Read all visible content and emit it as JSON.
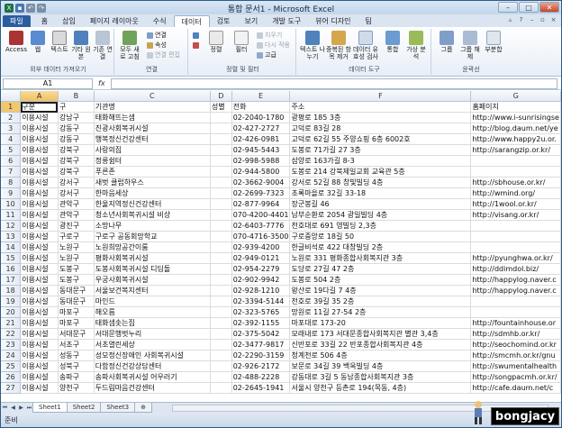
{
  "window": {
    "title": "통합 문서1 - Microsoft Excel"
  },
  "tabs": [
    "파일",
    "홈",
    "삽입",
    "페이지 레이아웃",
    "수식",
    "데이터",
    "검토",
    "보기",
    "개발 도구",
    "뷰어 디자인",
    "팀"
  ],
  "active_tab": "데이터",
  "ribbon": {
    "groups": [
      {
        "caption": "외부 데이터 가져오기",
        "buttons": [
          "Access",
          "웹",
          "텍스트",
          "기타 원본",
          "기존 연결"
        ]
      },
      {
        "caption": "연결",
        "buttons": [
          "모두 새로 고침"
        ],
        "small": [
          "연결",
          "속성",
          "연결 편집"
        ]
      },
      {
        "caption": "정렬 및 필터",
        "buttons": [
          "정렬",
          "필터"
        ],
        "small": [
          "지우기",
          "다시 적용",
          "고급"
        ]
      },
      {
        "caption": "데이터 도구",
        "buttons": [
          "텍스트 나누기",
          "중복된 항목 제거",
          "데이터 유효성 검사",
          "통합",
          "가상 분석"
        ]
      },
      {
        "caption": "윤곽선",
        "buttons": [
          "그룹",
          "그룹 해제",
          "부분합"
        ]
      }
    ]
  },
  "formula_bar": {
    "name_box": "A1",
    "fx": "fx",
    "value": ""
  },
  "columns": [
    "A",
    "B",
    "C",
    "D",
    "E",
    "F",
    "G"
  ],
  "rows": [
    [
      "구분",
      "구",
      "기관명",
      "성별",
      "전화",
      "주소",
      "홈페이지"
    ],
    [
      "이용시설",
      "강남구",
      "태화해뜨는샘",
      "",
      "02-2040-1780",
      "광평로 185 3층",
      "http://www.i-sunrisingse"
    ],
    [
      "이용시설",
      "강동구",
      "진광사회복귀시설",
      "",
      "02-427-2727",
      "고덕로 83길 28",
      "http://blog.daum.net/ye"
    ],
    [
      "이용시설",
      "강동구",
      "행복정신건강센터",
      "",
      "02-426-0981",
      "고덕로 62길 55 주양쇼핑 6층 6002호",
      "http://www.happy2u.or."
    ],
    [
      "이용시설",
      "강북구",
      "사랑의집",
      "",
      "02-945-5443",
      "도봉로 71가길 27 3층",
      "http://sarangzip.or.kr/"
    ],
    [
      "이용시설",
      "강북구",
      "정릉쉼터",
      "",
      "02-998-5988",
      "삼양로 163가길 8-3",
      ""
    ],
    [
      "이용시설",
      "강북구",
      "푸른존",
      "",
      "02-944-5800",
      "도봉로 214 강북제일교회 교육관 5층",
      ""
    ],
    [
      "이용시설",
      "강서구",
      "새벗 클럽하우스",
      "",
      "02-3662-9004",
      "강서로 52길 88 창빛빌딩 4층",
      "http://sbhouse.or.kr/"
    ],
    [
      "이용시설",
      "강서구",
      "한마음세상",
      "",
      "02-2699-7323",
      "초록마을로 32길 33-18",
      "http://wmind.org/"
    ],
    [
      "이용시설",
      "관악구",
      "한울지역정신건강센터",
      "",
      "02-877-9964",
      "장군봉길 46",
      "http://1wool.or.kr/"
    ],
    [
      "이용시설",
      "관악구",
      "청소년사회복귀시설 비상",
      "",
      "070-4200-4401",
      "남부순환로 2054 광일빌딩 4층",
      "http://visang.or.kr/"
    ],
    [
      "이용시설",
      "광진구",
      "소망나무",
      "",
      "02-6403-7776",
      "천호대로 691 영빌딩 2,3층",
      ""
    ],
    [
      "이용시설",
      "구로구",
      "구로구 공동회망학교",
      "",
      "070-4716-3500",
      "구로중앙로 18길 50",
      ""
    ],
    [
      "이용시설",
      "노원구",
      "노원희망공간이룸",
      "",
      "02-939-4200",
      "한글비석로 422 대창빌딩 2층",
      ""
    ],
    [
      "이용시설",
      "노원구",
      "평화사회복귀시설",
      "",
      "02-949-0121",
      "노원로 331 평화종합사회복지관 3층",
      "http://pyunghwa.or.kr/"
    ],
    [
      "이용시설",
      "도봉구",
      "도봉사회복귀시설 디딤돌",
      "",
      "02-954-2279",
      "도당로 27길 47 2층",
      "http://ddimdol.biz/"
    ],
    [
      "이용시설",
      "도봉구",
      "우궁사회복귀시설",
      "",
      "02-902-9942",
      "도봉로 504 2층",
      "http://happylog.naver.c"
    ],
    [
      "이용시설",
      "동대문구",
      "서울보건복지센터",
      "",
      "02-928-1210",
      "왕산로 19다길 7 4층",
      "http://happylog.naver.c"
    ],
    [
      "이용시설",
      "동대문구",
      "마인드",
      "",
      "02-3394-5144",
      "천호로 39길 35 2층",
      ""
    ],
    [
      "이용시설",
      "마포구",
      "해오름",
      "",
      "02-323-5765",
      "망원로 11길 27-54 2층",
      ""
    ],
    [
      "이용시설",
      "마포구",
      "태화샘솟는집",
      "",
      "02-392-1155",
      "마포대로 173-20",
      "http://fountainhouse.or"
    ],
    [
      "이용시설",
      "서대문구",
      "서대문행벗누리",
      "",
      "02-375-5042",
      "모래내로 173 서대문종합사회복지관 별관 3,4층",
      "http://sdmhb.or.kr/"
    ],
    [
      "이용시설",
      "서초구",
      "서초열린세상",
      "",
      "02-3477-9817",
      "신반포로 33길 22 반포종합사회복지관 4층",
      "http://seochomind.or.kr"
    ],
    [
      "이용시설",
      "성동구",
      "성모정신장애인 사회복귀시설",
      "",
      "02-2290-3159",
      "청계천로 506 4층",
      "http://smcmh.or.kr/gnu"
    ],
    [
      "이용시설",
      "성북구",
      "다함정신건강상담센터",
      "",
      "02-926-2172",
      "보문로 34길 39 백옥빌딩 4층",
      "http://swumentalhealth"
    ],
    [
      "이용시설",
      "송파구",
      "송파사회복귀시설 어우러기",
      "",
      "02-488-2228",
      "강동대로 3길 5 동남종합사회복지관 3층",
      "http://songpacmh.or.kr/"
    ],
    [
      "이용시설",
      "양천구",
      "두드림마음건강센터",
      "",
      "02-2645-1941",
      "서울시 양천구 등촌로 194(목동, 4층)",
      "http://cafe.daum.net/c"
    ]
  ],
  "sheets": [
    "Sheet1",
    "Sheet2",
    "Sheet3"
  ],
  "active_sheet": "Sheet1",
  "status": {
    "ready": "준비"
  },
  "watermark": "bongjacy",
  "colors": {
    "file_tab": "#2b5c9e",
    "ribbon_bg": "#e7eef7",
    "selected_header": "#f1c15f"
  }
}
